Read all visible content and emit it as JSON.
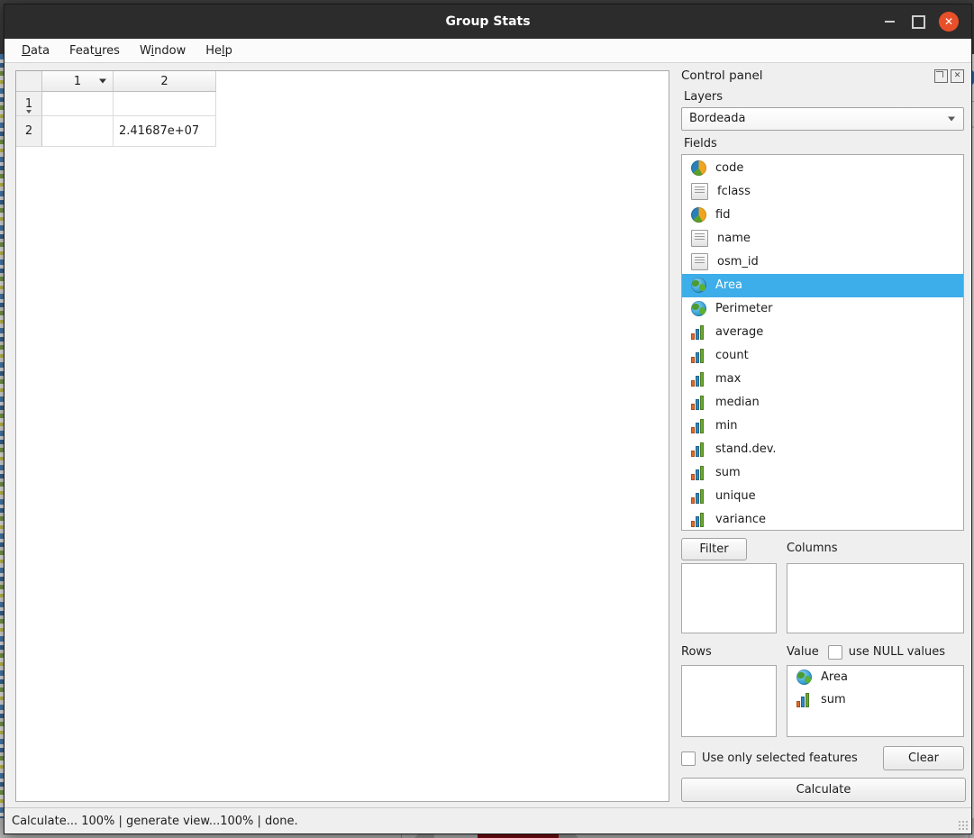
{
  "window": {
    "title": "Group Stats",
    "controls": {
      "minimize": "–",
      "maximize": "□",
      "close": "✕"
    }
  },
  "menubar": {
    "items": [
      {
        "label": "Data",
        "mnemonic": "D",
        "before": "",
        "after": "ata"
      },
      {
        "label": "Features",
        "mnemonic": "u",
        "before": "Feat",
        "after": "res"
      },
      {
        "label": "Window",
        "mnemonic": "i",
        "before": "W",
        "after": "ndow"
      },
      {
        "label": "Help",
        "mnemonic": "l",
        "before": "He",
        "after": "p"
      }
    ]
  },
  "result_table": {
    "columns": [
      "1",
      "2"
    ],
    "row_headers": [
      "1",
      "2"
    ],
    "rows": [
      {
        "header": "1",
        "cells": [
          "",
          ""
        ]
      },
      {
        "header": "2",
        "cells": [
          "",
          "2.41687e+07"
        ]
      }
    ]
  },
  "control_panel": {
    "title": "Control panel",
    "float_icon": "float-icon",
    "close_icon": "close-icon",
    "layers_label": "Layers",
    "layer_selected": "Bordeada",
    "fields_label": "Fields",
    "fields": [
      {
        "label": "code",
        "icon": "number-field-icon",
        "selected": false
      },
      {
        "label": "fclass",
        "icon": "text-field-icon",
        "selected": false
      },
      {
        "label": "fid",
        "icon": "number-field-icon",
        "selected": false
      },
      {
        "label": "name",
        "icon": "text-field-icon",
        "selected": false
      },
      {
        "label": "osm_id",
        "icon": "text-field-icon",
        "selected": false
      },
      {
        "label": "Area",
        "icon": "geometry-field-icon",
        "selected": true
      },
      {
        "label": "Perimeter",
        "icon": "geometry-field-icon",
        "selected": false
      },
      {
        "label": "average",
        "icon": "statistic-icon",
        "selected": false
      },
      {
        "label": "count",
        "icon": "statistic-icon",
        "selected": false
      },
      {
        "label": "max",
        "icon": "statistic-icon",
        "selected": false
      },
      {
        "label": "median",
        "icon": "statistic-icon",
        "selected": false
      },
      {
        "label": "min",
        "icon": "statistic-icon",
        "selected": false
      },
      {
        "label": "stand.dev.",
        "icon": "statistic-icon",
        "selected": false
      },
      {
        "label": "sum",
        "icon": "statistic-icon",
        "selected": false
      },
      {
        "label": "unique",
        "icon": "statistic-icon",
        "selected": false
      },
      {
        "label": "variance",
        "icon": "statistic-icon",
        "selected": false
      }
    ],
    "filter_button": "Filter",
    "columns_label": "Columns",
    "columns_items": [],
    "rows_label": "Rows",
    "rows_items": [],
    "value_label": "Value",
    "use_null_label": "use NULL values",
    "use_null_checked": false,
    "value_items": [
      {
        "label": "Area",
        "icon": "geometry-field-icon"
      },
      {
        "label": "sum",
        "icon": "statistic-icon"
      }
    ],
    "use_selected_label": "Use only selected features",
    "use_selected_checked": false,
    "clear_button": "Clear",
    "calculate_button": "Calculate"
  },
  "statusbar": {
    "text": "Calculate... 100% |  generate view...100% |  done."
  },
  "colors": {
    "titlebar": "#2c2c2c",
    "close_button": "#e8502a",
    "selection": "#3daee9",
    "panel_bg": "#efefef",
    "cell_tint": "#f8eaea"
  }
}
